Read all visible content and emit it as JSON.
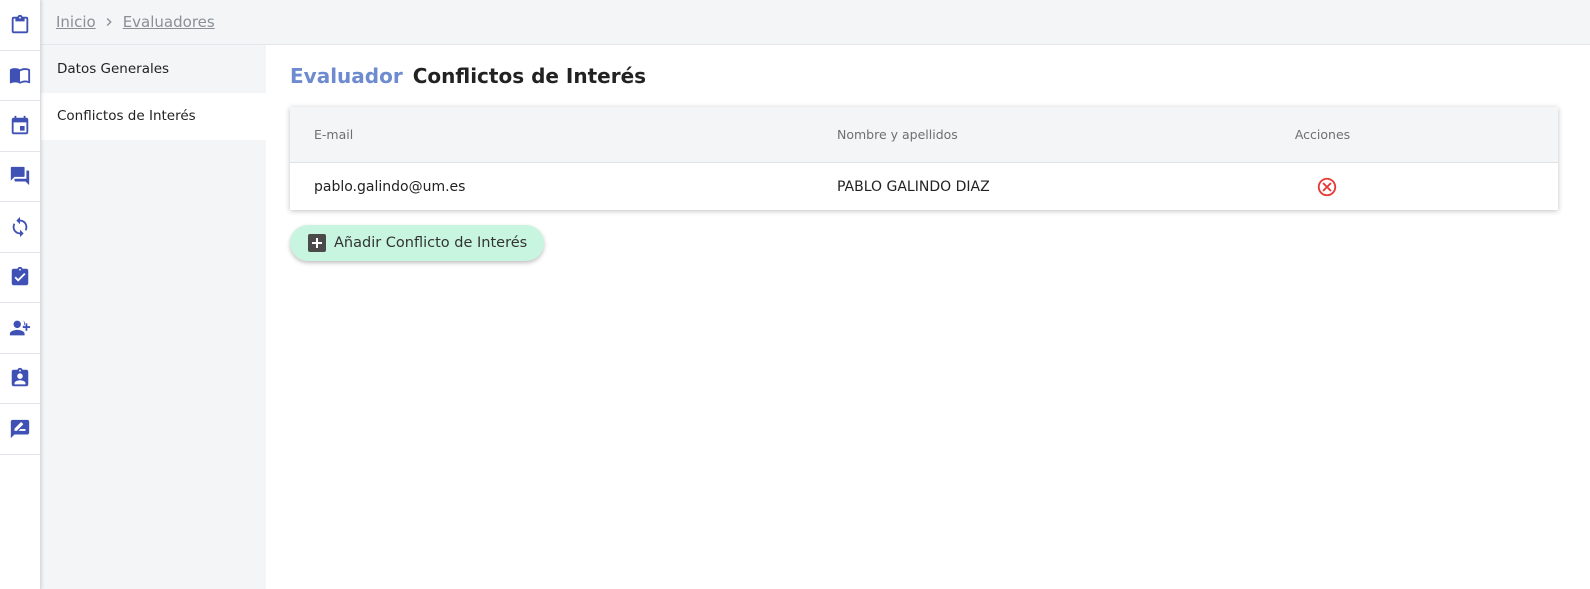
{
  "rail": {
    "items": [
      {
        "icon": "clipboard-icon"
      },
      {
        "icon": "book-open-icon"
      },
      {
        "icon": "calendar-icon"
      },
      {
        "icon": "forum-icon"
      },
      {
        "icon": "sync-icon"
      },
      {
        "icon": "assignment-turned-in-icon"
      },
      {
        "icon": "person-add-icon"
      },
      {
        "icon": "assignment-ind-icon"
      },
      {
        "icon": "rate-review-icon"
      }
    ],
    "icon_color": "#3f51b5"
  },
  "breadcrumb": {
    "items": [
      "Inicio",
      "Evaluadores"
    ]
  },
  "subnav": {
    "items": [
      {
        "label": "Datos Generales",
        "active": false
      },
      {
        "label": "Conflictos de Interés",
        "active": true
      }
    ]
  },
  "page": {
    "title_prefix": "Evaluador",
    "title": "Conflictos de Interés"
  },
  "table": {
    "columns": [
      "E-mail",
      "Nombre y apellidos",
      "Acciones"
    ],
    "rows": [
      {
        "email": "pablo.galindo@um.es",
        "name": "PABLO GALINDO DIAZ",
        "action_icon": "cancel-icon"
      }
    ]
  },
  "add_button": {
    "label": "Añadir Conflicto de Interés",
    "icon": "add-box-icon",
    "background": "#c8f5e0"
  },
  "colors": {
    "accent": "#6f8bd0",
    "danger": "#e53935"
  }
}
